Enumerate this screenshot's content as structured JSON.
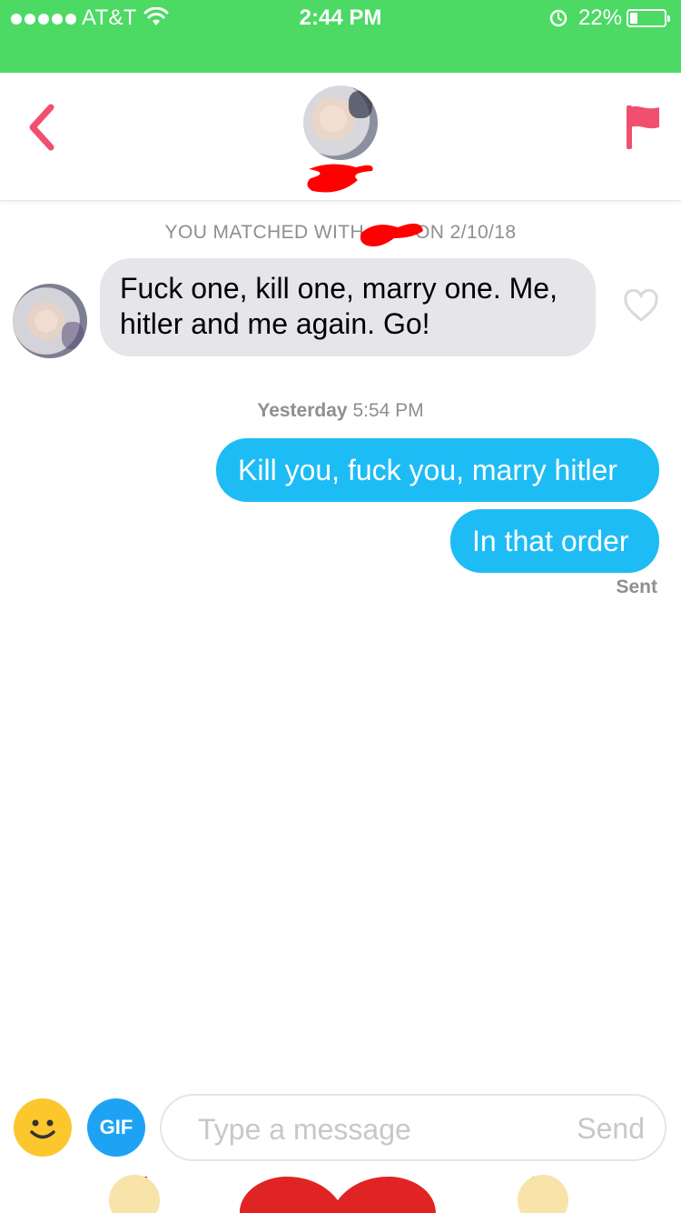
{
  "status_bar": {
    "carrier": "AT&T",
    "time": "2:44 PM",
    "battery_percent": "22%",
    "battery_level": 0.22,
    "background_color": "#4cd964"
  },
  "header": {
    "back_icon": "chevron-left-icon",
    "report_icon": "flag-icon",
    "accent_color": "#f0506e"
  },
  "chat": {
    "match_prefix": "YOU MATCHED WITH",
    "match_suffix": "ON 2/10/18",
    "messages_in": [
      {
        "text": "Fuck one, kill one, marry one. Me, hitler and me again. Go!"
      }
    ],
    "divider": {
      "day": "Yesterday",
      "time": "5:54 PM"
    },
    "messages_out": [
      {
        "text": "Kill you, fuck you, marry hitler"
      },
      {
        "text": "In that order"
      }
    ],
    "sent_status": "Sent",
    "outgoing_color": "#1ebcf5",
    "incoming_color": "#e5e5ea"
  },
  "composer": {
    "emoji_icon": "smiley-icon",
    "gif_label": "GIF",
    "placeholder": "Type a message",
    "send_label": "Send"
  }
}
